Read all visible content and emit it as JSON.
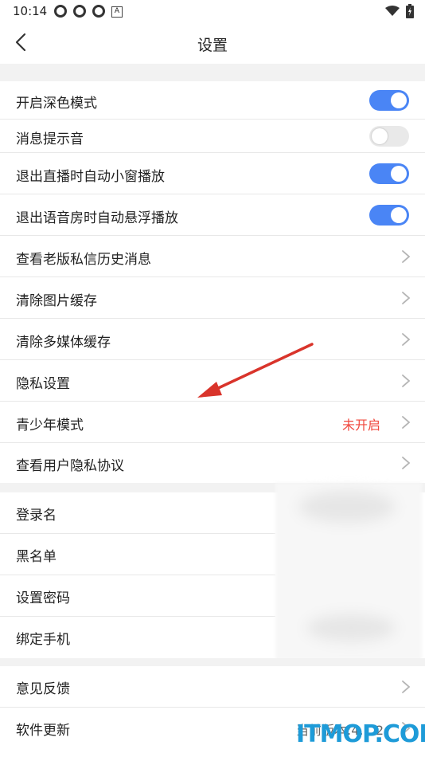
{
  "status_bar": {
    "time": "10:14",
    "icons": [
      "gear-icon",
      "gear-icon",
      "gear-icon",
      "a-icon"
    ],
    "badge_text": "A"
  },
  "header": {
    "title": "设置"
  },
  "section1": [
    {
      "label": "开启深色模式",
      "type": "toggle",
      "on": true
    },
    {
      "label": "消息提示音",
      "type": "toggle",
      "on": false
    },
    {
      "label": "退出直播时自动小窗播放",
      "type": "toggle",
      "on": true
    },
    {
      "label": "退出语音房时自动悬浮播放",
      "type": "toggle",
      "on": true
    },
    {
      "label": "查看老版私信历史消息",
      "type": "link"
    },
    {
      "label": "清除图片缓存",
      "type": "link"
    },
    {
      "label": "清除多媒体缓存",
      "type": "link"
    },
    {
      "label": "隐私设置",
      "type": "link"
    },
    {
      "label": "青少年模式",
      "type": "link",
      "value": "未开启",
      "value_color": "#f0483e"
    },
    {
      "label": "查看用户隐私协议",
      "type": "link"
    }
  ],
  "section2": [
    {
      "label": "登录名"
    },
    {
      "label": "黑名单"
    },
    {
      "label": "设置密码"
    },
    {
      "label": "绑定手机"
    }
  ],
  "section3": [
    {
      "label": "意见反馈",
      "type": "link"
    },
    {
      "label": "软件更新",
      "type": "link",
      "value": "当前版本:4.1.2",
      "value_color": "#666666"
    }
  ],
  "watermark": "ITMOP.COM",
  "colors": {
    "toggle_on": "#4a85f5",
    "toggle_off": "#e9e9e9",
    "arrow": "#d9342b",
    "warning": "#f0483e"
  }
}
